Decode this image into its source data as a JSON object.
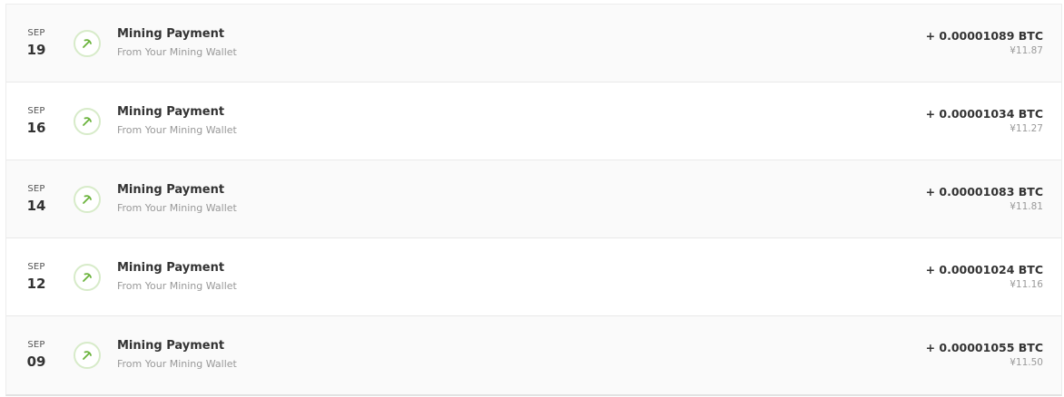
{
  "colors": {
    "icon_accent": "#6bb33c",
    "icon_ring": "#d7ebc9"
  },
  "transactions": [
    {
      "month": "SEP",
      "day": "19",
      "icon": "pickaxe-icon",
      "title": "Mining Payment",
      "subtitle": "From Your Mining Wallet",
      "amount_btc": "+ 0.00001089 BTC",
      "amount_fiat": "¥11.87"
    },
    {
      "month": "SEP",
      "day": "16",
      "icon": "pickaxe-icon",
      "title": "Mining Payment",
      "subtitle": "From Your Mining Wallet",
      "amount_btc": "+ 0.00001034 BTC",
      "amount_fiat": "¥11.27"
    },
    {
      "month": "SEP",
      "day": "14",
      "icon": "pickaxe-icon",
      "title": "Mining Payment",
      "subtitle": "From Your Mining Wallet",
      "amount_btc": "+ 0.00001083 BTC",
      "amount_fiat": "¥11.81"
    },
    {
      "month": "SEP",
      "day": "12",
      "icon": "pickaxe-icon",
      "title": "Mining Payment",
      "subtitle": "From Your Mining Wallet",
      "amount_btc": "+ 0.00001024 BTC",
      "amount_fiat": "¥11.16"
    },
    {
      "month": "SEP",
      "day": "09",
      "icon": "pickaxe-icon",
      "title": "Mining Payment",
      "subtitle": "From Your Mining Wallet",
      "amount_btc": "+ 0.00001055 BTC",
      "amount_fiat": "¥11.50"
    }
  ]
}
